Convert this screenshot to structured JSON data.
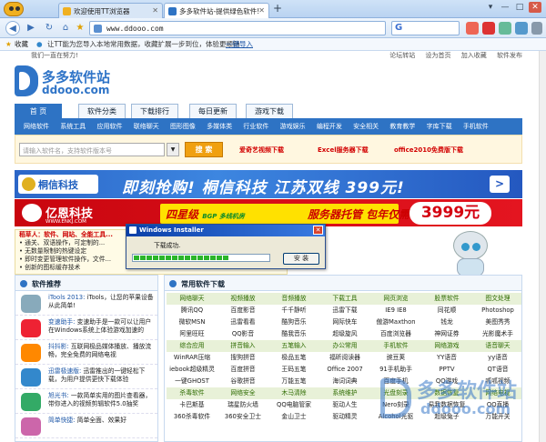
{
  "browser": {
    "tabs": [
      {
        "label": "欢迎使用TT浏览器",
        "fav_color": "#f0b020"
      },
      {
        "label": "多多软件站-提供绿色软件!",
        "fav_color": "#2e73c4"
      }
    ],
    "new_tab": "+",
    "window_buttons": [
      "▾",
      "—",
      "□",
      "✕"
    ],
    "url": "www.ddooo.com",
    "favbar_label": "收藏",
    "favbar_tip": "让TT能为您导入本地常用数据，收藏扩展一步到位，体验更顺畅",
    "favbar_link": "一键导入"
  },
  "site": {
    "welcome": "我们一直在努力!",
    "top_links": [
      "论坛转站",
      "设为首页",
      "加入收藏",
      "软件发布"
    ],
    "logo_cn": "多多软件站",
    "logo_en": "ddooo.com",
    "nav": [
      "首 页",
      "软件分类",
      "下载排行",
      "每日更新",
      "游戏下载"
    ],
    "subnav": [
      "网络软件",
      "系统工具",
      "应用软件",
      "联络聊天",
      "图形图像",
      "多媒体类",
      "行业软件",
      "游戏娱乐",
      "编程开发",
      "安全相关",
      "教育教学",
      "字库下载",
      "手机软件"
    ],
    "search_placeholder": "请输入软件名，支持软件版本号",
    "search_button": "搜 索",
    "hot_links": [
      "爱奇艺视频下载",
      "Excel服务器下载",
      "office2010免费版下载"
    ],
    "ad1_logo": "桐信科技",
    "ad1_text": "即刻抢购! 桐信科技 江苏双线 399元!",
    "ad1_arrow": ">",
    "ad2_logo": "亿恩科技",
    "ad2_logo_url": "WWW.ENKJ.COM",
    "ad2_mid": "四星级",
    "ad2_mid_tag": "BGP 多线机房",
    "ad2_right": "服务器托管 包年仅需",
    "ad2_price": "3999元",
    "news": [
      "稻草人：软件、网站、全能工具...",
      "• 通关、双语操作，可定制的...",
      "• 无数量限制的热键设定",
      "• 即时变更管理软件操作，文件...",
      "• 创新的图标缓存技术"
    ],
    "dialog": {
      "title": "Windows Installer",
      "message": "下载成功.",
      "progress": 0.7,
      "button": "安 装",
      "close": "✕"
    },
    "left_title": "软件推荐",
    "recs": [
      {
        "title": "iTools 2013:",
        "desc": "iTools，让您的苹果设备从此简单!",
        "color": "#8ab"
      },
      {
        "title": "变速助手:",
        "desc": "变速助手是一款可以让用户在Windows系统上体验游戏加速的",
        "color": "#e23"
      },
      {
        "title": "抖抖影:",
        "desc": "互联网极品媒体播放、播放流畅，完全免费的网络电视",
        "color": "#f80"
      },
      {
        "title": "迅雷极速版:",
        "desc": "迅雷推出的一键轻松下载，为用户提供更快下载体验",
        "color": "#38c"
      },
      {
        "title": "旭光书:",
        "desc": "一款简单实用的图片查看器，带你进入的视频剪辑软件5.0抽奖",
        "color": "#3a6"
      },
      {
        "title": "简单快捷:",
        "desc": "简单全面、效果好",
        "color": "#c6a"
      }
    ],
    "right_title": "常用软件下载",
    "grid": [
      {
        "cat": true,
        "cells": [
          "网络聊天",
          "视频播放",
          "音频播放",
          "下载工具",
          "网页浏览",
          "股票软件",
          "图文处理"
        ]
      },
      {
        "cat": false,
        "cells": [
          "腾讯QQ",
          "百度影音",
          "千千静听",
          "迅雷下载",
          "IE9 IE8",
          "同花顺",
          "Photoshop"
        ]
      },
      {
        "cat": false,
        "cells": [
          "微软MSN",
          "迅雷看看",
          "酷狗音乐",
          "网际快车",
          "傲游Maxthon",
          "钱龙",
          "美图秀秀"
        ]
      },
      {
        "cat": false,
        "cells": [
          "阿里旺旺",
          "QQ影音",
          "酷我音乐",
          "超级旋风",
          "百度浏览器",
          "神网证券",
          "光影魔术手"
        ]
      },
      {
        "cat": true,
        "cells": [
          "综合应用",
          "拼音输入",
          "五笔输入",
          "办公常用",
          "手机软件",
          "网络游戏",
          "语音聊天"
        ]
      },
      {
        "cat": false,
        "cells": [
          "WinRAR压缩",
          "搜狗拼音",
          "极品五笔",
          "福昕阅读器",
          "豌豆荚",
          "YY语音",
          "yy语音"
        ]
      },
      {
        "cat": false,
        "cells": [
          "iebook超级精灵",
          "百度拼音",
          "王码五笔",
          "Office 2007",
          "91手机助手",
          "PPTV",
          "QT语音"
        ]
      },
      {
        "cat": false,
        "cells": [
          "一键GHOST",
          "谷歌拼音",
          "万能五笔",
          "海词词典",
          "百度手机",
          "QQ游戏",
          "呱呱视频"
        ]
      },
      {
        "cat": true,
        "cells": [
          "杀毒软件",
          "网络安全",
          "木马清除",
          "系统维护",
          "光盘刻录",
          "数据恢复",
          "网络电视"
        ]
      },
      {
        "cat": false,
        "cells": [
          "卡巴斯基",
          "瑞星防火墙",
          "QQ电脑管家",
          "驱动人生",
          "Nero刻录",
          "易我数据恢复",
          "QQ直播"
        ]
      },
      {
        "cat": false,
        "cells": [
          "360杀毒软件",
          "360安全卫士",
          "金山卫士",
          "驱动精灵",
          "Alcohol光驱",
          "超级兔子",
          "万能开关"
        ]
      }
    ],
    "watermark_cn": "多多软件站",
    "watermark_en": "ddooo.com"
  }
}
